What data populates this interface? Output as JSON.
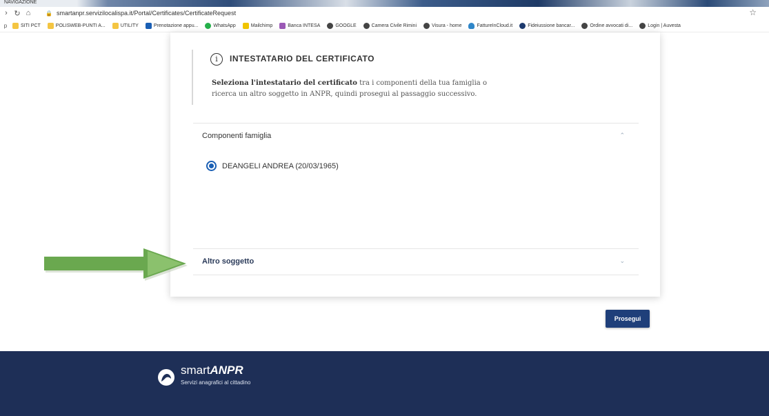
{
  "browser": {
    "tab_label": "NAVIGAZIONE",
    "url": "smartanpr.servizilocalispa.it/Portal/Certificates/CertificateRequest",
    "bookmarks": [
      {
        "label": "SITI PCT",
        "icon": "folder"
      },
      {
        "label": "POLISWEB-PUNTI A...",
        "icon": "folder"
      },
      {
        "label": "UTILITY",
        "icon": "folder"
      },
      {
        "label": "Prenotazione appu...",
        "icon": "blue"
      },
      {
        "label": "WhatsApp",
        "icon": "green"
      },
      {
        "label": "Mailchimp",
        "icon": "yellow"
      },
      {
        "label": "Banca INTESA",
        "icon": "purple"
      },
      {
        "label": "GOOGLE",
        "icon": "globe"
      },
      {
        "label": "Camera Civile Rimini",
        "icon": "globe"
      },
      {
        "label": "Visura - home",
        "icon": "globe"
      },
      {
        "label": "FattureInCloud.it",
        "icon": "cloud"
      },
      {
        "label": "Fideiussione bancar...",
        "icon": "dark"
      },
      {
        "label": "Ordine avvocati di...",
        "icon": "globe"
      },
      {
        "label": "Login | Auvesta",
        "icon": "globe"
      }
    ]
  },
  "info": {
    "title": "INTESTATARIO DEL CERTIFICATO",
    "text_bold": "Seleziona l'intestatario del certificato",
    "text_rest": " tra i componenti della tua famiglia o ricerca un altro soggetto in ANPR, quindi prosegui al passaggio successivo."
  },
  "sections": {
    "famiglia": {
      "label": "Componenti famiglia",
      "expanded": true,
      "members": [
        {
          "name": "DEANGELI ANDREA (20/03/1965)",
          "selected": true
        }
      ]
    },
    "altro": {
      "label": "Altro soggetto",
      "expanded": false
    }
  },
  "actions": {
    "prosegui_label": "Prosegui"
  },
  "footer": {
    "logo_smart": "smart",
    "logo_anpr": "ANPR",
    "tagline": "Servizi anagrafici al cittadino"
  },
  "colors": {
    "primary": "#1f3f7a",
    "footer": "#1e2f57",
    "arrow": "#6aa84f"
  }
}
